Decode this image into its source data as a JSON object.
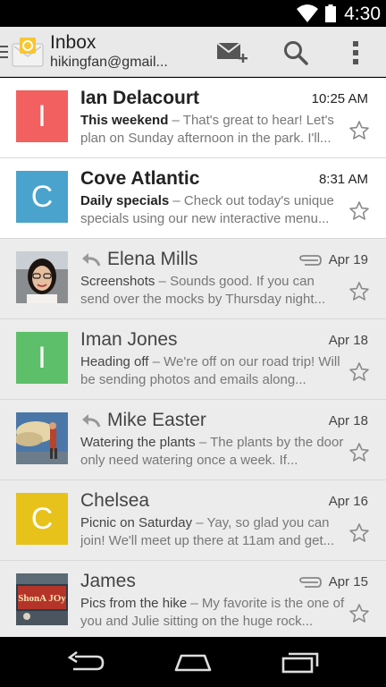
{
  "status_bar": {
    "time": "4:30"
  },
  "action_bar": {
    "title": "Inbox",
    "account": "hikingfan@gmail...",
    "actions": [
      {
        "id": "compose",
        "icon": "compose-mail-icon"
      },
      {
        "id": "search",
        "icon": "search-icon"
      },
      {
        "id": "overflow",
        "icon": "overflow-menu-icon"
      }
    ]
  },
  "emails": [
    {
      "sender": "Ian Delacourt",
      "time": "10:25 AM",
      "subject": "This weekend",
      "snippet": "That's great to hear! Let's plan on Sunday afternoon in the park. I'll...",
      "unread": true,
      "replied": false,
      "attachment": false,
      "avatar_letter": "I",
      "avatar_color": "#f26060",
      "avatar_type": "letter"
    },
    {
      "sender": "Cove Atlantic",
      "time": "8:31 AM",
      "subject": "Daily specials",
      "snippet": "Check out today's unique specials using our new interactive menu...",
      "unread": true,
      "replied": false,
      "attachment": false,
      "avatar_letter": "C",
      "avatar_color": "#4aa3cc",
      "avatar_type": "letter"
    },
    {
      "sender": "Elena Mills",
      "time": "Apr 19",
      "subject": "Screenshots",
      "snippet": "Sounds good. If you can send over the mocks by Thursday night...",
      "unread": false,
      "replied": true,
      "attachment": true,
      "avatar_type": "photo-woman"
    },
    {
      "sender": "Iman Jones",
      "time": "Apr 18",
      "subject": "Heading off",
      "snippet": "We're off on our road trip! Will be sending photos and emails along...",
      "unread": false,
      "replied": false,
      "attachment": false,
      "avatar_letter": "I",
      "avatar_color": "#5dbf6a",
      "avatar_type": "letter"
    },
    {
      "sender": "Mike Easter",
      "time": "Apr 18",
      "subject": "Watering the plants",
      "snippet": "The plants by the door only need watering once a week. If...",
      "unread": false,
      "replied": true,
      "attachment": false,
      "avatar_type": "photo-sky"
    },
    {
      "sender": "Chelsea",
      "time": "Apr 16",
      "subject": "Picnic on Saturday",
      "snippet": "Yay, so glad you can join! We'll meet up there at 11am and get...",
      "unread": false,
      "replied": false,
      "attachment": false,
      "avatar_letter": "C",
      "avatar_color": "#e7c21a",
      "avatar_type": "letter"
    },
    {
      "sender": "James",
      "time": "Apr 15",
      "subject": "Pics from the hike",
      "snippet": "My favorite is the one of you and Julie sitting on the huge rock...",
      "unread": false,
      "replied": false,
      "attachment": true,
      "avatar_type": "photo-sign"
    }
  ],
  "separator": " – ",
  "nav_bar": {
    "buttons": [
      "back-icon",
      "home-icon",
      "recents-icon"
    ]
  }
}
